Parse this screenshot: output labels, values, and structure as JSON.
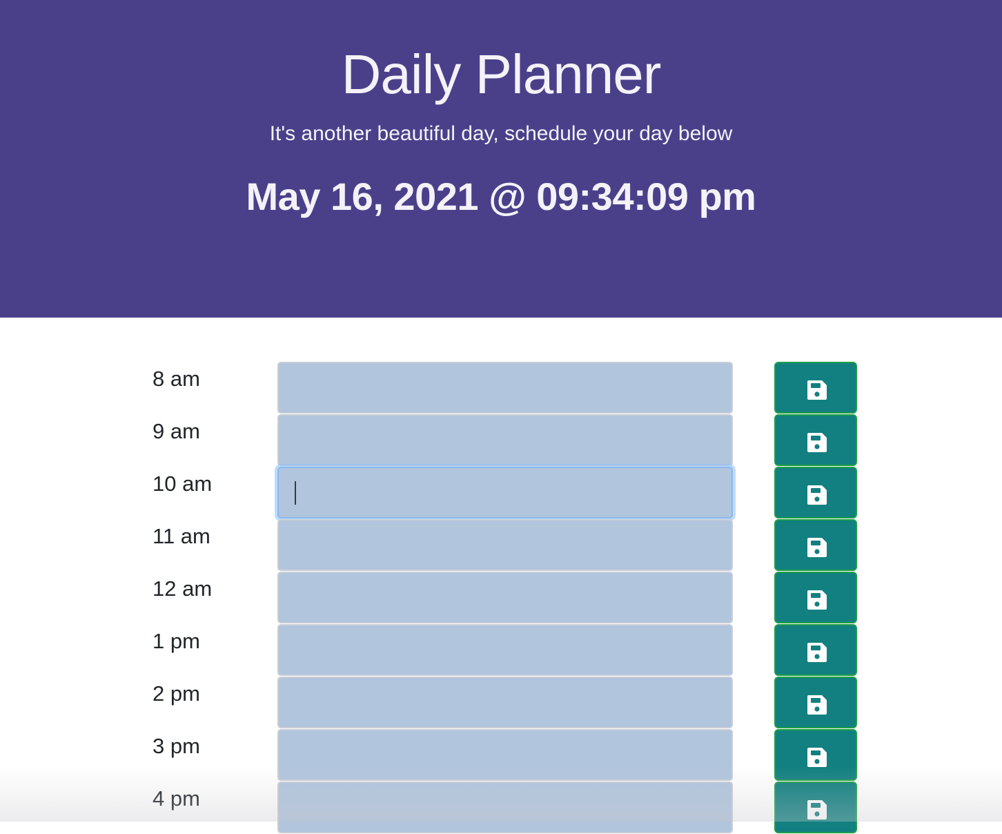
{
  "header": {
    "title": "Daily Planner",
    "subtitle": "It's another beautiful day, schedule your day below",
    "datetime": "May 16, 2021 @ 09:34:09 pm"
  },
  "planner": {
    "rows": [
      {
        "hour": "8 am",
        "task": ""
      },
      {
        "hour": "9 am",
        "task": ""
      },
      {
        "hour": "10 am",
        "task": ""
      },
      {
        "hour": "11 am",
        "task": ""
      },
      {
        "hour": "12 am",
        "task": ""
      },
      {
        "hour": "1 pm",
        "task": ""
      },
      {
        "hour": "2 pm",
        "task": ""
      },
      {
        "hour": "3 pm",
        "task": ""
      },
      {
        "hour": "4 pm",
        "task": ""
      }
    ],
    "focused_row": "10 am",
    "save_icon": "floppy-disk-icon"
  },
  "colors": {
    "header_bg": "#4a408a",
    "task_bg": "#b1c5dd",
    "save_button_bg": "#128080",
    "save_button_border": "#1e9e46"
  }
}
